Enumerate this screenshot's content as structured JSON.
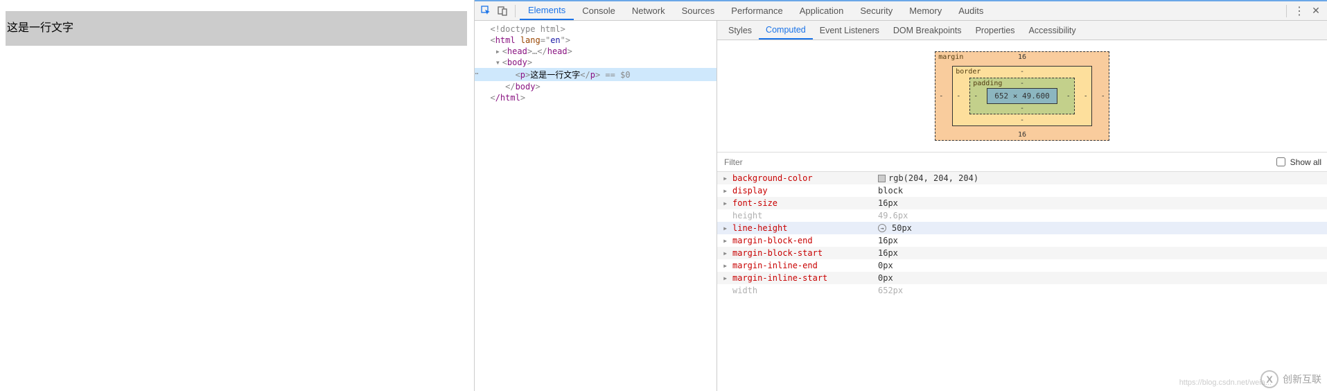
{
  "page": {
    "paragraph_text": "这是一行文字"
  },
  "devtools": {
    "tabs": [
      "Elements",
      "Console",
      "Network",
      "Sources",
      "Performance",
      "Application",
      "Security",
      "Memory",
      "Audits"
    ],
    "active_tab": "Elements"
  },
  "dom": {
    "doctype": "<!doctype html>",
    "html_open": "html",
    "html_lang_attr": "lang",
    "html_lang_val": "en",
    "head_label": "head",
    "body_label": "body",
    "p_label": "p",
    "p_text": "这是一行文字",
    "eqsel": "== $0",
    "html_close": "/html"
  },
  "side_tabs": [
    "Styles",
    "Computed",
    "Event Listeners",
    "DOM Breakpoints",
    "Properties",
    "Accessibility"
  ],
  "side_active": "Computed",
  "box_model": {
    "margin_label": "margin",
    "margin_top": "16",
    "margin_bottom": "16",
    "margin_left": "-",
    "margin_right": "-",
    "border_label": "border",
    "border_val": "-",
    "padding_label": "padding",
    "padding_val": "-",
    "content": "652 × 49.600"
  },
  "filter": {
    "placeholder": "Filter",
    "showall_label": "Show all"
  },
  "computed": [
    {
      "name": "background-color",
      "value": "rgb(204, 204, 204)",
      "tri": true,
      "swatch": true
    },
    {
      "name": "display",
      "value": "block",
      "tri": true
    },
    {
      "name": "font-size",
      "value": "16px",
      "tri": true
    },
    {
      "name": "height",
      "value": "49.6px",
      "dim": true
    },
    {
      "name": "line-height",
      "value": "50px",
      "tri": true,
      "highlight": true,
      "dot": true
    },
    {
      "name": "margin-block-end",
      "value": "16px",
      "tri": true
    },
    {
      "name": "margin-block-start",
      "value": "16px",
      "tri": true
    },
    {
      "name": "margin-inline-end",
      "value": "0px",
      "tri": true
    },
    {
      "name": "margin-inline-start",
      "value": "0px",
      "tri": true
    },
    {
      "name": "width",
      "value": "652px",
      "dim": true
    }
  ],
  "watermark": {
    "logo_text": "X",
    "brand": "创新互联"
  },
  "url_wm": "https://blog.csdn.net/weia..."
}
